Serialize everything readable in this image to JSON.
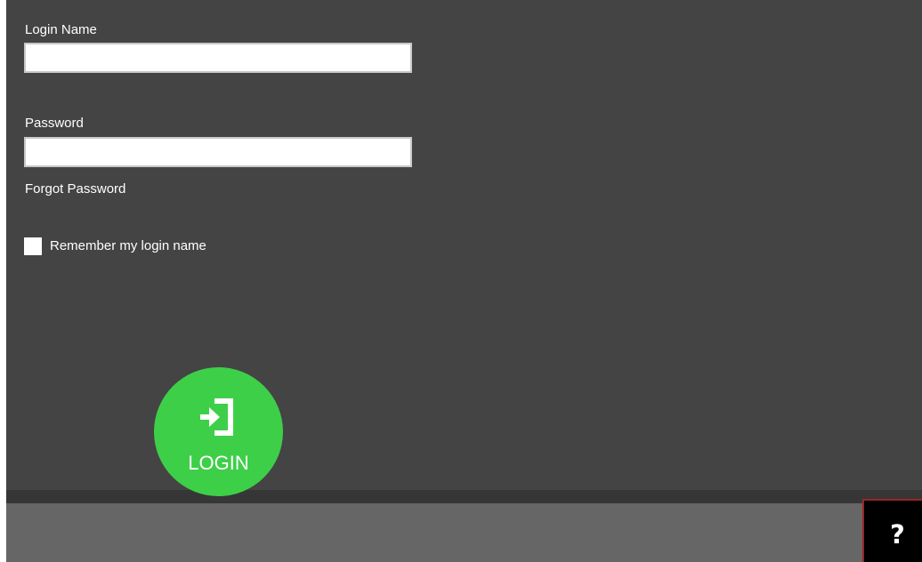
{
  "login_form": {
    "login_name_label": "Login Name",
    "login_name_value": "",
    "password_label": "Password",
    "password_value": "",
    "forgot_password_link": "Forgot Password",
    "remember_label": "Remember my login name",
    "remember_checked": false,
    "login_button_label": "LOGIN",
    "login_icon": "sign-in-icon",
    "login_button_color": "#3ecf49"
  },
  "footer": {
    "help_icon": "question-mark-icon",
    "help_glyph": "?"
  },
  "colors": {
    "panel_background": "#444444",
    "bottom_bar": "#666666",
    "help_button_background": "#000000",
    "help_button_border": "#9a2525"
  }
}
